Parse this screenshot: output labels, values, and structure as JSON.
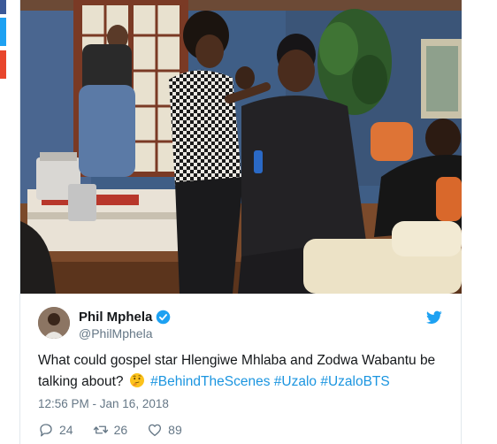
{
  "share_strip": {
    "colors": [
      "#3b5998",
      "#1da1f2",
      "#e8452c"
    ]
  },
  "tweet": {
    "author": {
      "display_name": "Phil Mphela",
      "handle": "@PhilMphela",
      "verified": true
    },
    "text": {
      "lead": "What could gospel star Hlengiwe Mhlaba and Zodwa Wabantu be talking about?",
      "emoji": "thinking-face",
      "hashtags": [
        "#BehindTheScenes",
        "#Uzalo",
        "#UzaloBTS"
      ]
    },
    "timestamp": "12:56 PM - Jan 16, 2018",
    "stats": {
      "replies": "24",
      "retweets": "26",
      "likes": "89"
    }
  },
  "colors": {
    "link": "#1b95e0",
    "text": "#14171a",
    "muted": "#657786",
    "verified": "#1da1f2",
    "twitter_bird": "#1da1f2"
  },
  "icons": [
    "verified-badge-icon",
    "twitter-bird-icon",
    "reply-icon",
    "retweet-icon",
    "like-icon",
    "thinking-emoji-icon"
  ]
}
